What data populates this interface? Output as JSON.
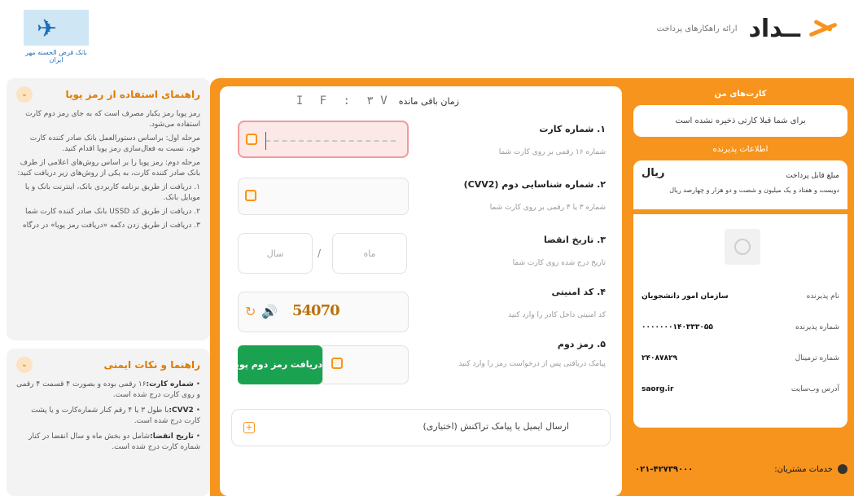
{
  "header": {
    "brand_name": "ــداد",
    "brand_tagline": "ارائه راهکارهای پرداخت",
    "bank_caption": "بانک قرض الحسنه مهر ایران"
  },
  "help": {
    "title": "راهنمای استفاده از رمز پویا",
    "paragraphs": [
      "رمز پویا رمز یکبار مصرف است که به جای رمز دوم کارت استفاده می‌شود.",
      "مرحله اول: براساس دستورالعمل بانک صادر کننده کارت خود، نسبت به فعال‌سازی رمز پویا اقدام کنید.",
      "مرحله دوم: رمز پویا را بر اساس روش‌های اعلامی از طرف بانک صادر کننده کارت، به یکی از روش‌های زیر دریافت کنید:",
      "۱. دریافت از طریق برنامه کاربردی بانک، اینترنت بانک و یا موبایل بانک.",
      "۲. دریافت از طریق کد USSD بانک صادر کننده کارت شما",
      "۳. دریافت از طریق زدن دکمه «دریافت رمز پویا» در درگاه"
    ]
  },
  "tips": {
    "title": "راهنما و نکات ایمنی",
    "items": [
      {
        "bold": "شماره کارت:",
        "text": "۱۶ رقمی بوده و بصورت ۴ قسمت ۴ رقمی و روی کارت درج شده است."
      },
      {
        "bold": "CVV2:",
        "text": "با طول ۳ یا ۴ رقم کنار شماره‌کارت و یا پشت کارت درج شده است."
      },
      {
        "bold": "تاریخ انقضا:",
        "text": "شامل دو بخش ماه و سال انقضا در کنار شماره کارت درج شده است."
      }
    ]
  },
  "form": {
    "timer_label": "زمان باقی مانده",
    "timer_value": "I F : ٣ V",
    "card_number_label": "۱. شماره کارت",
    "card_number_hint": "شماره ۱۶ رقمی بر روی کارت شما",
    "cvv2_label": "۲. شماره شناسایی دوم (CVV2)",
    "cvv2_hint": "شماره ۳ یا ۴ رقمی بر روی کارت شما",
    "expiry_label": "۳. تاریخ انقضا",
    "expiry_hint": "تاریخ درج شده روی کارت شما",
    "month_placeholder": "ماه",
    "year_placeholder": "سال",
    "slash": "/",
    "captcha_label": "۴. کد امنیتی",
    "captcha_hint": "کد امنیتی داخل کادر را وارد کنید",
    "captcha_text": "54070",
    "password_label": "۵. رمز دوم",
    "password_hint": "پیامک دریافتی پس از درخواست رمز را وارد کنید",
    "otp_button": "دریافت رمز دوم پویا",
    "email_label": "ارسال ایمیل یا پیامک تراکنش (اختیاری)"
  },
  "side": {
    "my_cards_title": "کارت‌های من",
    "no_cards_text": "برای شما قبلا کارتی ذخیره نشده است",
    "merchant_info_title": "اطلاعات پذیرنده",
    "payable_label": "مبلغ قابل پرداخت",
    "currency": "ریال",
    "amount_words": "دویست و هفتاد و یک میلیون و شصت و دو هزار و چهارصد ریال",
    "rows": [
      {
        "key": "نام پذیرنده",
        "value": "سازمان امور دانشجویان"
      },
      {
        "key": "شماره پذیرنده",
        "value": "۰۰۰۰۰۰۰۱۴۰۳۳۳۰۵۵"
      },
      {
        "key": "شماره ترمینال",
        "value": "۲۴۰۸۷۸۲۹"
      },
      {
        "key": "آدرس وب‌سایت",
        "value": "saorg.ir"
      }
    ],
    "support_label": "خدمات مشتریان:",
    "support_number": "۰۲۱-۴۲۷۳۹۰۰۰"
  }
}
